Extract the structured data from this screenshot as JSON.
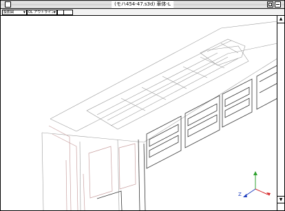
{
  "window": {
    "title": "(モハ454-47.s3d) 車体-L"
  },
  "toolbar": {
    "view_select": "投影図",
    "display_mode": "OL アウトライン"
  },
  "axes": {
    "x_label": "",
    "y_label": "",
    "z_label": "Z"
  },
  "icons": {
    "close": "close-box-icon",
    "zoom": "zoom-box-icon",
    "collapse": "collapse-box-icon",
    "tool_a": "select-tool-icon",
    "tool_b": "measure-tool-icon"
  }
}
